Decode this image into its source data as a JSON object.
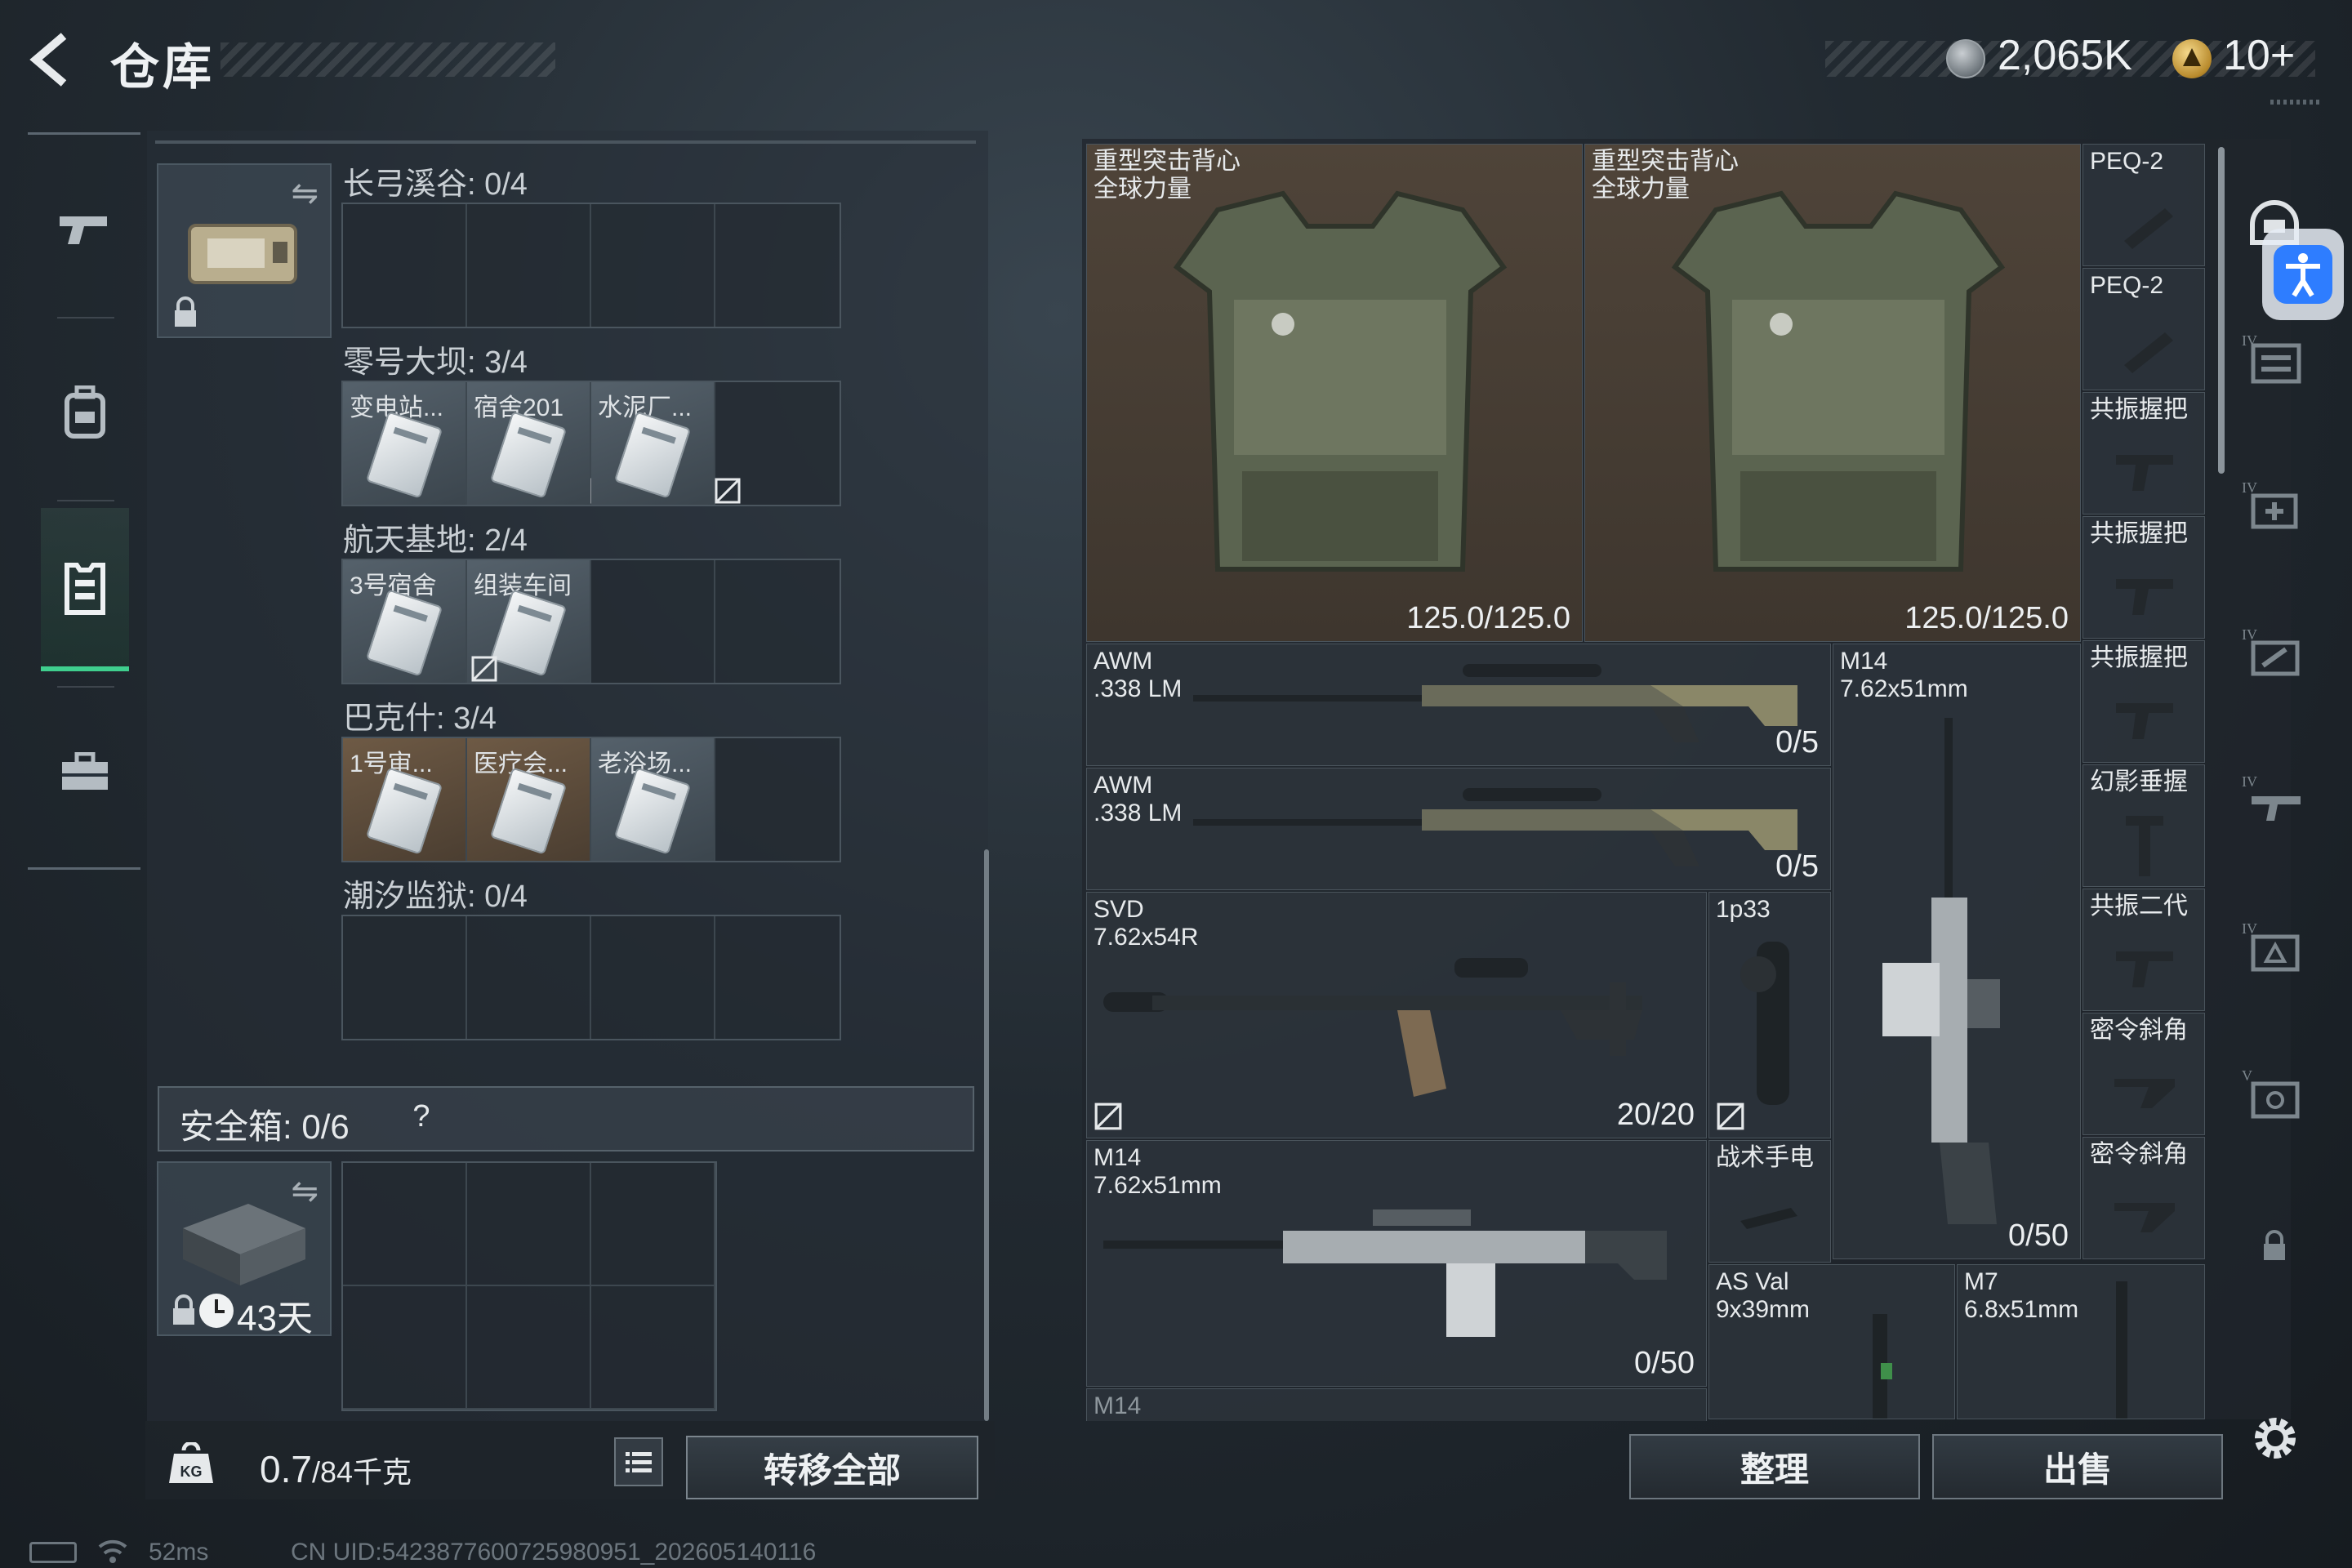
{
  "header": {
    "title": "仓库",
    "coins": "2,065K",
    "tickets": "10+"
  },
  "nav": {
    "items": [
      "weapon-icon",
      "backpack-icon",
      "armor-vest-icon",
      "briefcase-icon"
    ],
    "active_index": 2
  },
  "keycard_case": {
    "maps": [
      {
        "name": "长弓溪谷: 0/4",
        "cards": []
      },
      {
        "name": "零号大坝: 3/4",
        "cards": [
          "变电站...",
          "宿舍201",
          "水泥厂..."
        ]
      },
      {
        "name": "航天基地: 2/4",
        "cards": [
          "3号宿舍",
          "组装车间"
        ]
      },
      {
        "name": "巴克什: 3/4",
        "cards": [
          "1号审...",
          "医疗会...",
          "老浴场..."
        ]
      },
      {
        "name": "潮汐监狱: 0/4",
        "cards": []
      }
    ]
  },
  "safe_box": {
    "label": "安全箱:",
    "count": "0/6",
    "help": "?",
    "days": "43天"
  },
  "footer_left": {
    "weight_current": "0.7",
    "weight_max": "/84千克",
    "transfer_all": "转移全部"
  },
  "inventory": {
    "vest1": {
      "name": "重型突击背心\n全球力量",
      "durability": "125.0/125.0"
    },
    "vest2": {
      "name": "重型突击背心\n全球力量",
      "durability": "125.0/125.0"
    },
    "col_attachments": [
      "PEQ-2",
      "PEQ-2",
      "共振握把",
      "共振握把",
      "共振握把",
      "幻影垂握",
      "共振二代",
      "密令斜角",
      "密令斜角"
    ],
    "awm1": {
      "name": "AWM\n.338 LM",
      "ammo": "0/5"
    },
    "awm2": {
      "name": "AWM\n.338 LM",
      "ammo": "0/5"
    },
    "m14_tall": {
      "name": "M14\n7.62x51mm",
      "ammo": "0/50"
    },
    "svd": {
      "name": "SVD\n7.62x54R",
      "ammo": "20/20"
    },
    "scope": {
      "name": "1p33"
    },
    "m14_wide": {
      "name": "M14\n7.62x51mm",
      "ammo": "0/50"
    },
    "flashlight": {
      "name": "战术手电"
    },
    "asval": {
      "name": "AS Val\n9x39mm"
    },
    "m7": {
      "name": "M7\n6.8x51mm"
    },
    "partial": {
      "name": "M14"
    }
  },
  "footer_right": {
    "sort": "整理",
    "sell": "出售"
  },
  "status": {
    "ping": "52ms",
    "uid": "CN UID:5423877600725980951_202605140116"
  },
  "colors": {
    "accent_green": "#3fcf8e",
    "vest_slot": "#4f4439",
    "accessibility_blue": "#2e7dff"
  }
}
